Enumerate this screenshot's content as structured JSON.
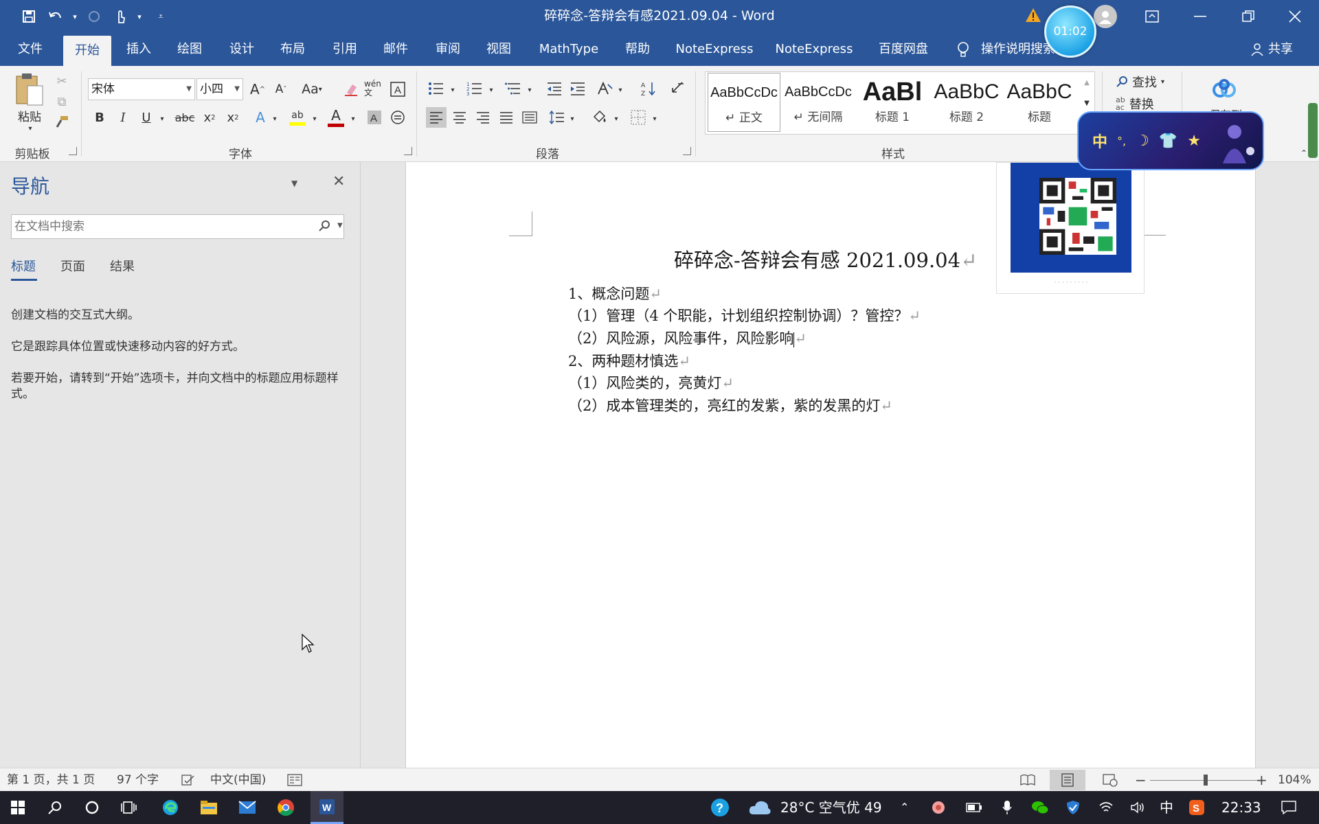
{
  "titlebar": {
    "title": "碎碎念-答辩会有感2021.09.04  -  Word",
    "timer": "01:02"
  },
  "menu": {
    "tabs": [
      "文件",
      "开始",
      "插入",
      "绘图",
      "设计",
      "布局",
      "引用",
      "邮件",
      "审阅",
      "视图",
      "MathType",
      "帮助",
      "NoteExpress",
      "NoteExpress",
      "百度网盘"
    ],
    "active_tab": "开始",
    "help_search": "操作说明搜索",
    "share": "共享"
  },
  "ribbon": {
    "clipboard": {
      "label": "剪贴板",
      "paste": "粘贴"
    },
    "font": {
      "label": "字体",
      "font_name": "宋体",
      "font_size": "小四",
      "change_case": "Aa",
      "phonetic": "wén文"
    },
    "paragraph": {
      "label": "段落"
    },
    "styles": {
      "label": "样式",
      "items": [
        {
          "sample": "AaBbCcDc",
          "name": "↵ 正文"
        },
        {
          "sample": "AaBbCcDc",
          "name": "↵ 无间隔"
        },
        {
          "sample": "AaBl",
          "name": "标题 1"
        },
        {
          "sample": "AaBbC",
          "name": "标题 2"
        },
        {
          "sample": "AaBbC",
          "name": "标题"
        }
      ]
    },
    "editing": {
      "find": "查找",
      "replace": "替换"
    },
    "save_to": "保存到"
  },
  "ime": {
    "mode": "中"
  },
  "nav": {
    "title": "导航",
    "search_placeholder": "在文档中搜索",
    "tabs": [
      "标题",
      "页面",
      "结果"
    ],
    "text1": "创建文档的交互式大纲。",
    "text2": "它是跟踪具体位置或快速移动内容的好方式。",
    "text3": "若要开始，请转到“开始”选项卡，并向文档中的标题应用标题样式。"
  },
  "document": {
    "title": "碎碎念-答辩会有感 2021.09.04",
    "lines": [
      "1、概念问题",
      "（1）管理（4 个职能，计划组织控制协调）？管控？",
      "（2）风险源，风险事件，风险影响",
      "2、两种题材慎选",
      "（1）风险类的，亮黄灯",
      "（2）成本管理类的，亮红的发紫，紫的发黑的灯"
    ],
    "pilcrow": "↵"
  },
  "status": {
    "page": "第 1 页，共 1 页",
    "words": "97 个字",
    "language": "中文(中国)",
    "zoom": "104%",
    "zoom_level": 1.04
  },
  "taskbar": {
    "weather": "28°C  空气优 49",
    "ime": "中",
    "time": "22:33"
  },
  "colors": {
    "word_blue": "#2b579a",
    "font_red": "#c00000",
    "highlight_yellow": "#ffff00"
  }
}
